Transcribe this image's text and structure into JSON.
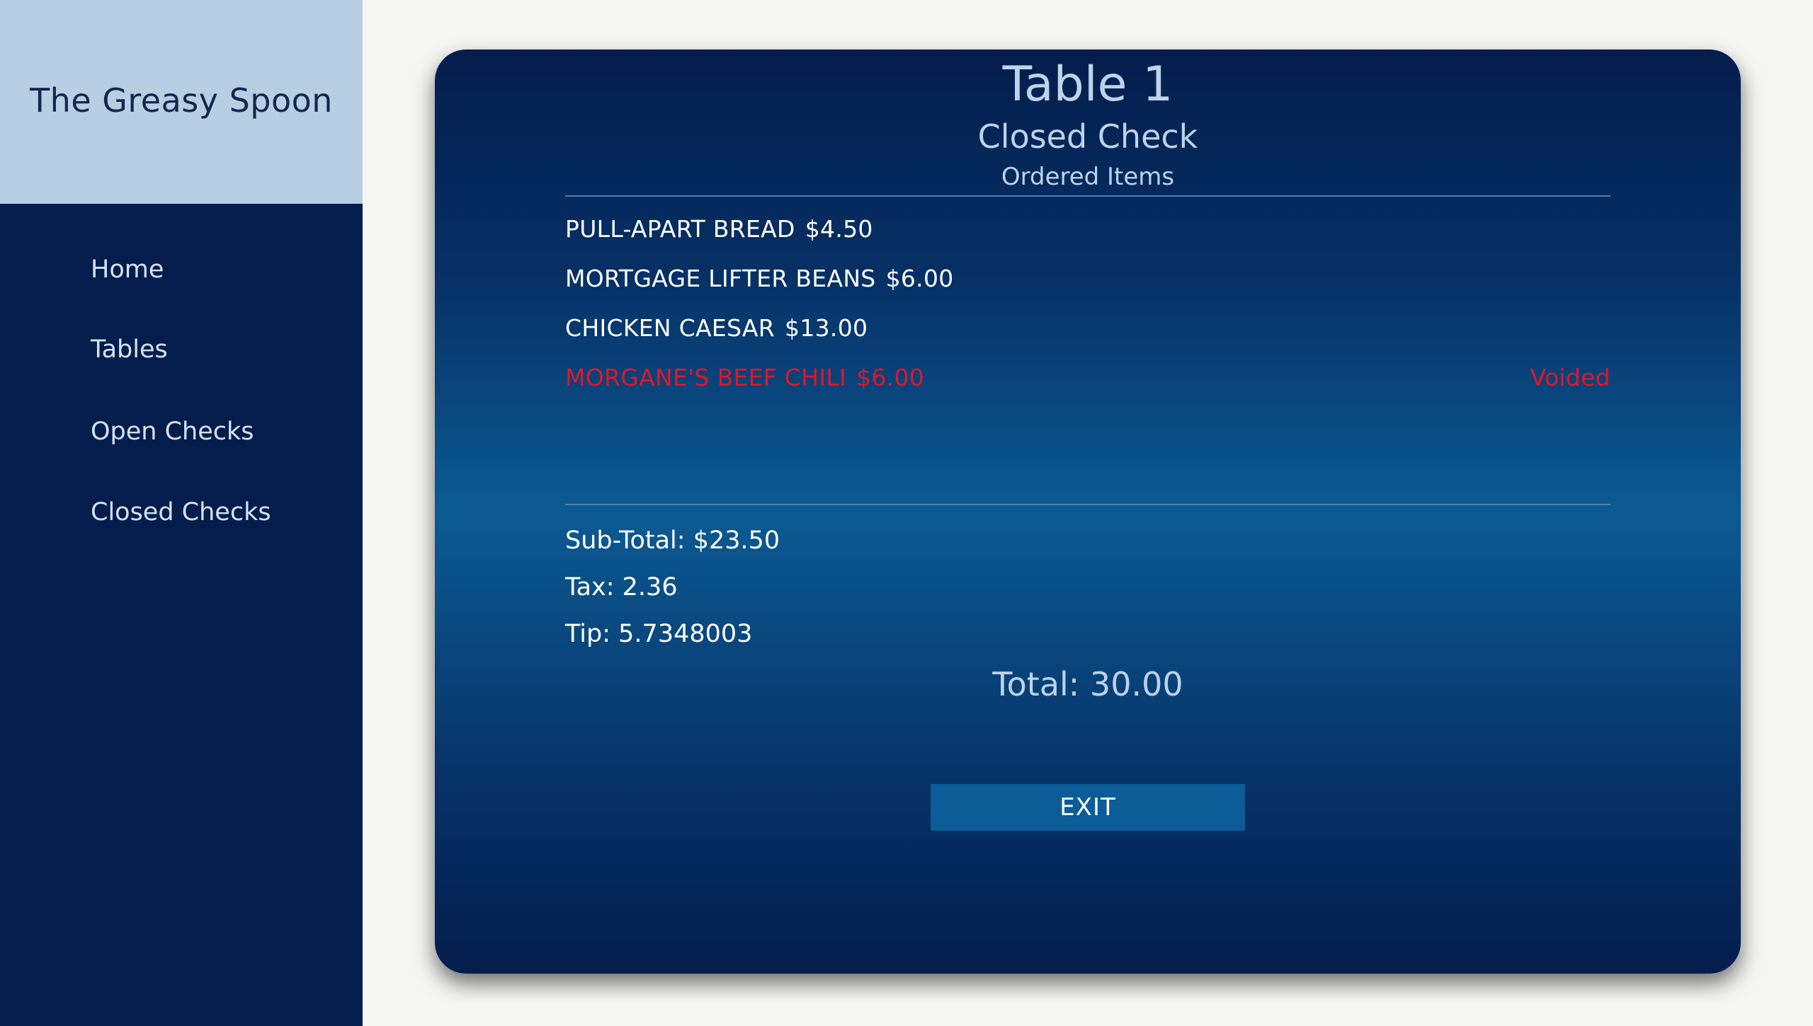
{
  "brand": {
    "title": "The Greasy Spoon"
  },
  "nav": {
    "items": [
      {
        "label": "Home"
      },
      {
        "label": "Tables"
      },
      {
        "label": "Open Checks"
      },
      {
        "label": "Closed Checks"
      }
    ]
  },
  "check": {
    "title": "Table 1",
    "subtitle": "Closed Check",
    "section_label": "Ordered Items",
    "items": [
      {
        "name": "PULL-APART BREAD",
        "price": "$4.50",
        "status": ""
      },
      {
        "name": "MORTGAGE LIFTER BEANS",
        "price": "$6.00",
        "status": ""
      },
      {
        "name": "CHICKEN CAESAR",
        "price": "$13.00",
        "status": ""
      },
      {
        "name": "MORGANE'S BEEF CHILI",
        "price": "$6.00",
        "status": "Voided"
      }
    ],
    "subtotal": "Sub-Total: $23.50",
    "tax": "Tax: 2.36",
    "tip": "Tip: 5.7348003",
    "total": "Total: 30.00",
    "exit_label": "EXIT"
  },
  "colors": {
    "sidebar_bg": "#041d4c",
    "brand_bg": "#b8cee3",
    "voided": "#e3152a",
    "exit_button": "#0c5c97"
  }
}
